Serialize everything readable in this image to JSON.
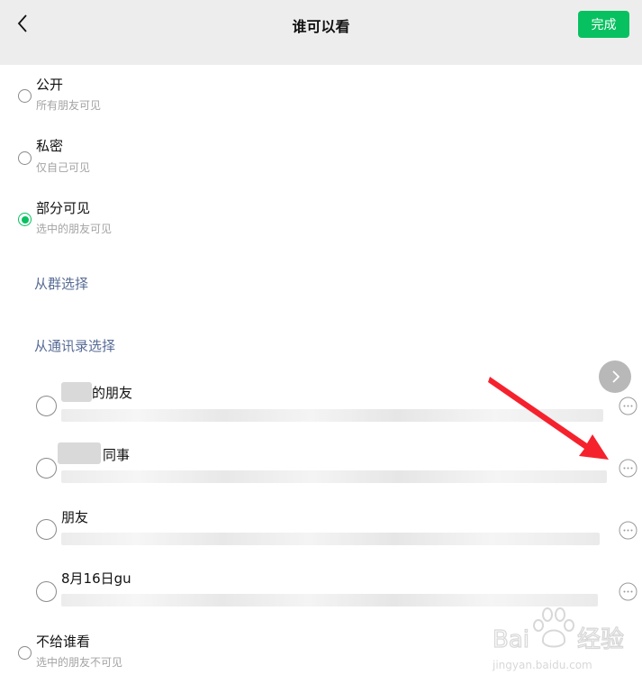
{
  "header": {
    "title": "谁可以看",
    "done_label": "完成"
  },
  "options": [
    {
      "title": "公开",
      "subtitle": "所有朋友可见",
      "checked": false
    },
    {
      "title": "私密",
      "subtitle": "仅自己可见",
      "checked": false
    },
    {
      "title": "部分可见",
      "subtitle": "选中的朋友可见",
      "checked": true
    }
  ],
  "links": {
    "from_group": "从群选择",
    "from_contacts": "从通讯录选择"
  },
  "groups": [
    {
      "name": "的朋友"
    },
    {
      "name": "同事"
    },
    {
      "name": "朋友"
    },
    {
      "name": "8月16日gu"
    }
  ],
  "exclude_option": {
    "title": "不给谁看",
    "subtitle": "选中的朋友不可见"
  },
  "watermark": {
    "brand": "Baidu经验",
    "url": "jingyan.baidu.com"
  },
  "colors": {
    "accent": "#07c160",
    "link": "#576b95",
    "annotation_arrow": "#f5222d"
  }
}
